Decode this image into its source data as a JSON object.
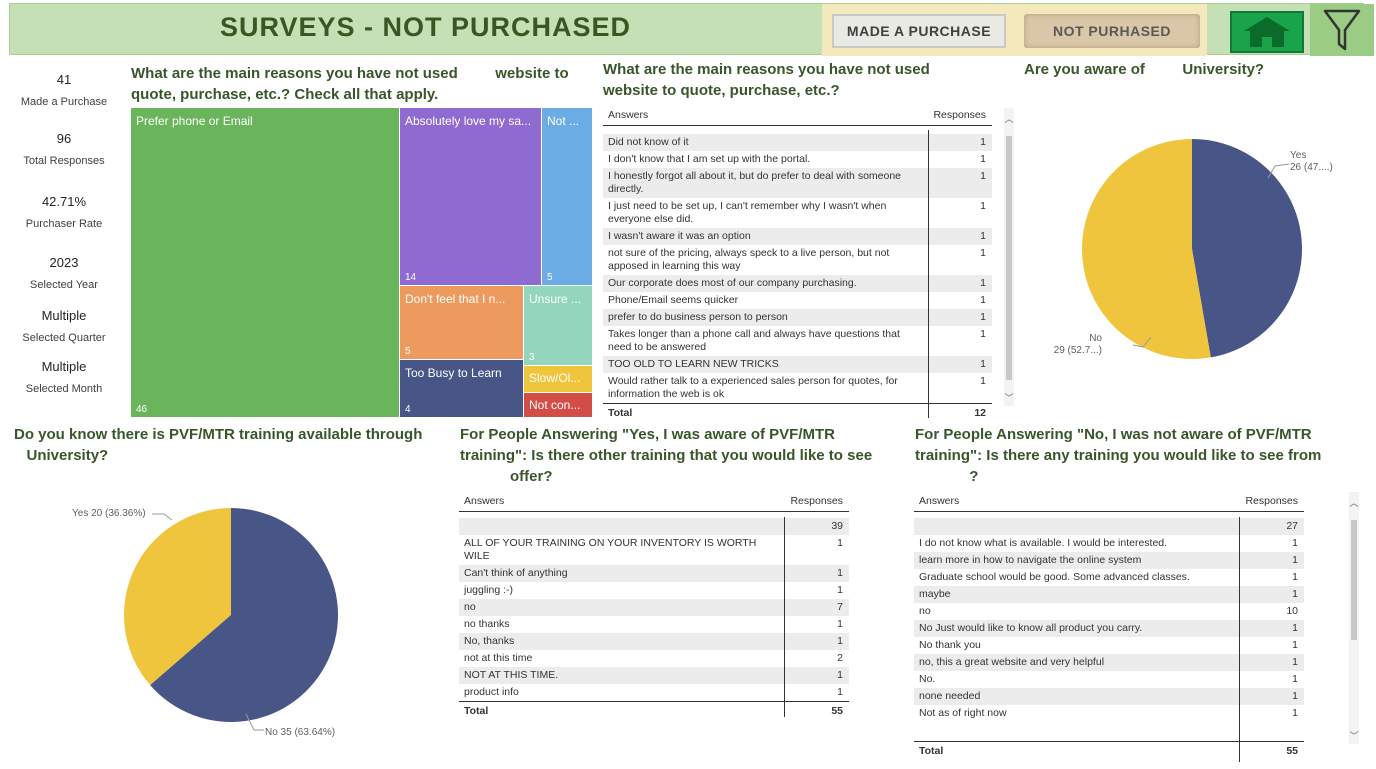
{
  "header": {
    "title": "SURVEYS - NOT PURCHASED",
    "made_purchase_label": "MADE A PURCHASE",
    "not_purchased_label": "NOT PURHASED",
    "home_icon": "home-icon",
    "filter_icon": "filter-icon"
  },
  "kpis": [
    {
      "value": "41",
      "label": "Made a Purchase"
    },
    {
      "value": "96",
      "label": "Total Responses"
    },
    {
      "value": "42.71%",
      "label": "Purchaser Rate"
    },
    {
      "value": "2023",
      "label": "Selected Year"
    },
    {
      "value": "Multiple",
      "label": "Selected Quarter"
    },
    {
      "value": "Multiple",
      "label": "Selected Month"
    }
  ],
  "treemap": {
    "title_line1": "What are the main reasons you have not used",
    "title_line1b": "website to",
    "title_line2": "quote, purchase, etc.? Check all that apply.",
    "items": [
      {
        "label": "Prefer phone or Email",
        "value": "46",
        "color": "#6ab55c"
      },
      {
        "label": "Absolutely love my sa...",
        "value": "14",
        "color": "#8f6bd1"
      },
      {
        "label": "Not ...",
        "value": "5",
        "color": "#6aace3"
      },
      {
        "label": "Don't feel that I n...",
        "value": "5",
        "color": "#ed9a5f"
      },
      {
        "label": "Unsure ...",
        "value": "3",
        "color": "#93d6bd"
      },
      {
        "label": "Too Busy to Learn",
        "value": "4",
        "color": "#485687"
      },
      {
        "label": "Slow/Ol...",
        "value": "",
        "color": "#f0c53e"
      },
      {
        "label": "Not con...",
        "value": "",
        "color": "#d34d47"
      }
    ]
  },
  "reasons_table": {
    "title_line1": "What are the main reasons you have not used",
    "title_line2": "website to quote, purchase, etc.?",
    "col_answers": "Answers",
    "col_responses": "Responses",
    "rows": [
      {
        "a": "Did not know of it",
        "r": "1"
      },
      {
        "a": "I don't know that I am set up with the portal.",
        "r": "1"
      },
      {
        "a": "I honestly forgot all about it, but do prefer to deal with someone directly.",
        "r": "1"
      },
      {
        "a": "I just need to be set up, I can't remember why I wasn't when everyone else did.",
        "r": "1"
      },
      {
        "a": "I wasn't aware it was an option",
        "r": "1"
      },
      {
        "a": "not sure of the pricing, always speck to a live person, but not apposed in learning this way",
        "r": "1"
      },
      {
        "a": "Our corporate does most of our company purchasing.",
        "r": "1"
      },
      {
        "a": "Phone/Email seems quicker",
        "r": "1"
      },
      {
        "a": "prefer to do business person to person",
        "r": "1"
      },
      {
        "a": "Takes longer than a phone call and always have questions that need to be answered",
        "r": "1"
      },
      {
        "a": "TOO OLD TO LEARN NEW TRICKS",
        "r": "1"
      },
      {
        "a": "Would rather talk to a experienced sales person for quotes, for information the web is ok",
        "r": "1"
      }
    ],
    "total_label": "Total",
    "total_value": "12"
  },
  "aware_pie": {
    "title_a": "Are you aware of",
    "title_b": "University?",
    "yes_label": "Yes",
    "yes_detail": "26 (47....)",
    "no_label": "No",
    "no_detail": "29 (52.7...)"
  },
  "training_pie": {
    "title_line1": "Do you know there is PVF/MTR training available through",
    "title_line2": "University?",
    "yes_label": "Yes 20 (36.36%)",
    "no_label": "No 35 (63.64%)"
  },
  "yes_table": {
    "title_line1": "For People Answering \"Yes, I was aware of PVF/MTR",
    "title_line2": "training\": Is there other training that you would like to see",
    "title_line3": "offer?",
    "col_answers": "Answers",
    "col_responses": "Responses",
    "rows": [
      {
        "a": "",
        "r": "39"
      },
      {
        "a": "ALL OF YOUR TRAINING ON YOUR INVENTORY IS WORTH WILE",
        "r": "1"
      },
      {
        "a": "Can't think of anything",
        "r": "1"
      },
      {
        "a": "juggling :-)",
        "r": "1"
      },
      {
        "a": "no",
        "r": "7"
      },
      {
        "a": "no thanks",
        "r": "1"
      },
      {
        "a": "No, thanks",
        "r": "1"
      },
      {
        "a": "not at this time",
        "r": "2"
      },
      {
        "a": "NOT AT THIS TIME.",
        "r": "1"
      },
      {
        "a": "product info",
        "r": "1"
      }
    ],
    "total_label": "Total",
    "total_value": "55"
  },
  "no_table": {
    "title_line1": "For People Answering \"No, I was not aware of PVF/MTR",
    "title_line2": "training\": Is there any training you would like to see from",
    "title_line3": "?",
    "col_answers": "Answers",
    "col_responses": "Responses",
    "rows": [
      {
        "a": "",
        "r": "27"
      },
      {
        "a": "I do not know what is available. I would be interested.",
        "r": "1"
      },
      {
        "a": "learn more in how to navigate the online system",
        "r": "1"
      },
      {
        "a": "Graduate school would be good. Some advanced classes.",
        "r": "1"
      },
      {
        "a": "maybe",
        "r": "1"
      },
      {
        "a": "no",
        "r": "10"
      },
      {
        "a": "No Just would like to know all product you carry.",
        "r": "1"
      },
      {
        "a": "No thank you",
        "r": "1"
      },
      {
        "a": "no, this a great website and very helpful",
        "r": "1"
      },
      {
        "a": "No.",
        "r": "1"
      },
      {
        "a": "none needed",
        "r": "1"
      },
      {
        "a": "Not as of right now",
        "r": "1"
      }
    ],
    "total_label": "Total",
    "total_value": "55"
  },
  "chart_data": [
    {
      "type": "pie",
      "title": "Are you aware of University?",
      "categories": [
        "Yes",
        "No"
      ],
      "values": [
        26,
        29
      ],
      "colors": [
        "#485687",
        "#f0c53e"
      ]
    },
    {
      "type": "pie",
      "title": "Do you know there is PVF/MTR training available through University?",
      "categories": [
        "Yes",
        "No"
      ],
      "values": [
        20,
        35
      ],
      "colors": [
        "#f0c53e",
        "#485687"
      ]
    }
  ]
}
